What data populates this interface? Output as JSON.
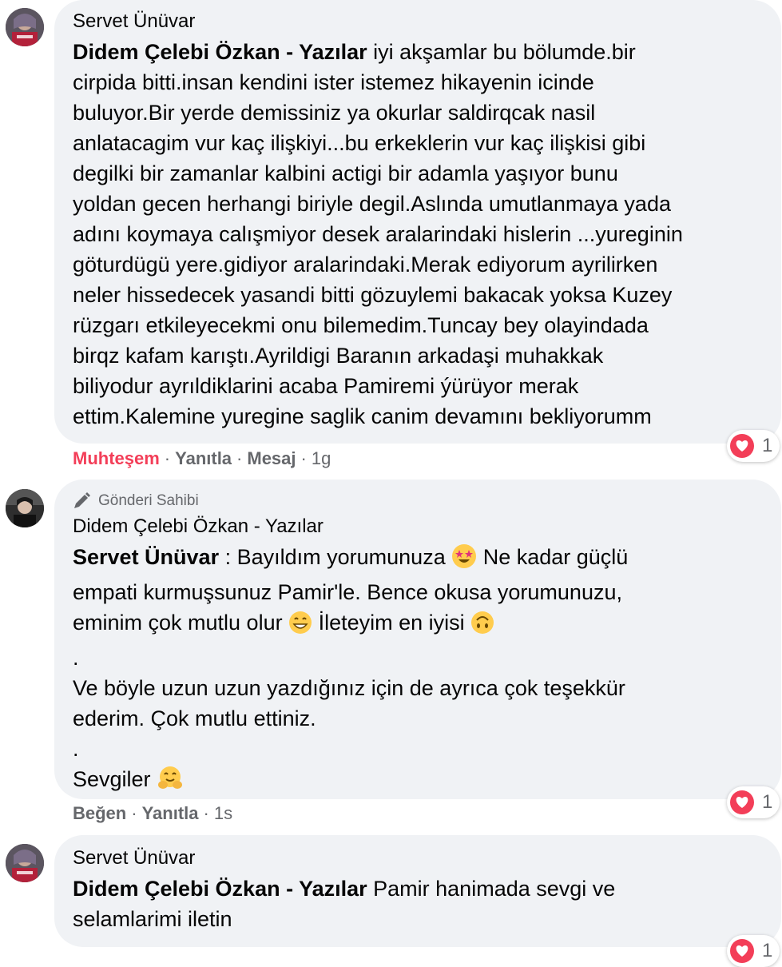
{
  "comments": [
    {
      "author": "Servet Ünüvar",
      "tag": "Didem Çelebi Özkan - Yazılar",
      "lines": [
        " iyi akşamlar bu bölumde.bir",
        "cirpida bitti.insan kendini ister istemez hikayenin icinde",
        "buluyor.Bir yerde demissiniz ya okurlar saldirqcak nasil",
        "anlatacagim vur kaç ilişkiyi...bu erkeklerin vur kaç ilişkisi gibi",
        "degilki bir zamanlar kalbini actigi bir adamla yaşıyor bunu",
        "yoldan gecen herhangi biriyle degil.Aslında umutlanmaya yada",
        "adını koymaya calışmiyor desek aralarindaki hislerin ...yureginin",
        "göturdügü yere.gidiyor aralarindaki.Merak ediyorum ayrilirken",
        "neler hissedecek yasandi bitti gözuylemi bakacak yoksa Kuzey",
        "rüzgarı etkileyecekmi onu bilemedim.Tuncay bey olayindada",
        "birqz kafam karıştı.Ayrildigi Baranın arkadaşi muhakkak",
        "biliyodur ayrıldiklarini acaba Pamiremi ýürüyor merak",
        "ettim.Kalemine yuregine saglik canim devamını bekliyorumm"
      ],
      "actions": {
        "reaction": "Muhteşem",
        "reply": "Yanıtla",
        "message": "Mesaj",
        "time": "1g"
      },
      "reaction_count": "1"
    },
    {
      "badge": "Gönderi Sahibi",
      "author": "Didem Çelebi Özkan - Yazılar",
      "tag": "Servet Ünüvar",
      "lines": {
        "l1a": " : Bayıldım yorumunuza ",
        "l1b": " Ne kadar güçlü",
        "l2": "empati kurmuşsunuz Pamir'le. Bence okusa yorumunuzu,",
        "l3a": "eminim çok mutlu olur ",
        "l3b": " İleteyim en iyisi ",
        "l4": ".",
        "l5": "Ve böyle uzun uzun yazdığınız için de ayrıca çok teşekkür",
        "l6": "ederim. Çok mutlu ettiniz.",
        "l7": ".",
        "l8": "Sevgiler "
      },
      "actions": {
        "like": "Beğen",
        "reply": "Yanıtla",
        "time": "1s"
      },
      "reaction_count": "1"
    },
    {
      "author": "Servet Ünüvar",
      "tag": "Didem Çelebi Özkan - Yazılar",
      "lines": [
        " Pamir hanimada sevgi ve",
        "selamlarimi iletin"
      ],
      "reaction_count": "1"
    }
  ],
  "colors": {
    "bubble": "#f0f2f5",
    "reaction_red": "#f33e58",
    "meta_gray": "#65676b"
  },
  "icons": [
    "heart-reaction-icon",
    "pencil-icon",
    "star-struck-emoji",
    "grinning-emoji",
    "upside-down-emoji",
    "hugging-emoji"
  ]
}
